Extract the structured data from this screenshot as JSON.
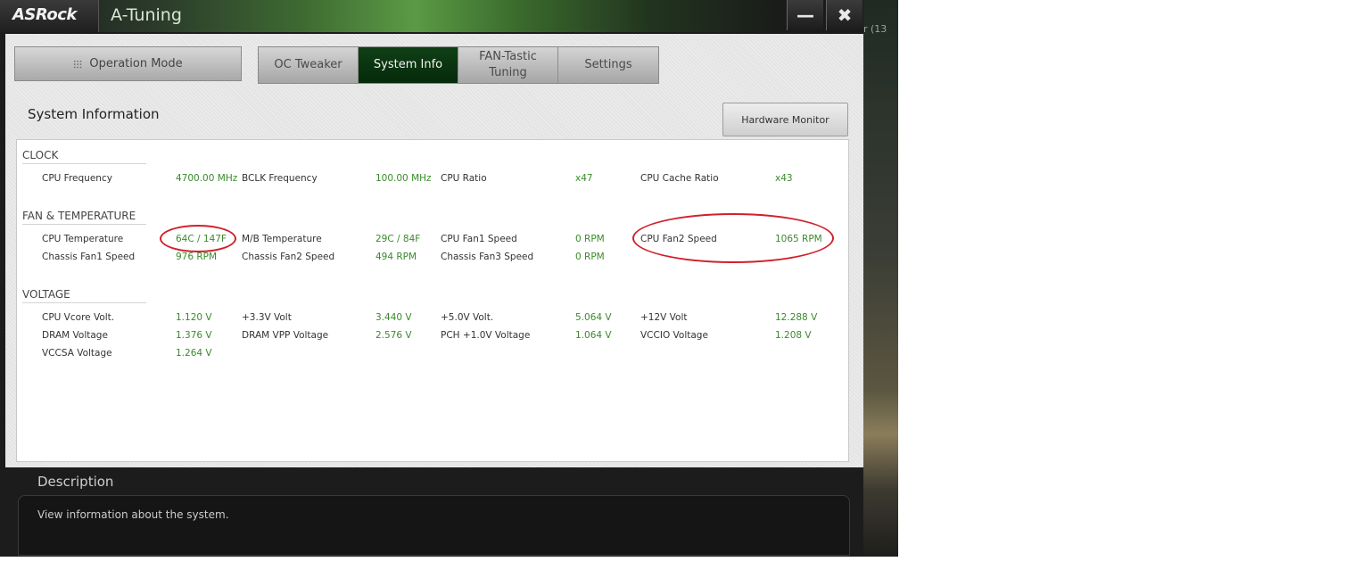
{
  "window": {
    "brand": "ASRock",
    "title": "A-Tuning",
    "minimize_glyph": "—",
    "close_glyph": "✖"
  },
  "background": {
    "snippet": "r (13"
  },
  "nav": {
    "operation_mode": "Operation Mode",
    "tabs": [
      {
        "label": "OC Tweaker",
        "active": false
      },
      {
        "label": "System Info",
        "active": true
      },
      {
        "label": "FAN-Tastic Tuning",
        "active": false
      },
      {
        "label": "Settings",
        "active": false
      }
    ]
  },
  "page": {
    "title": "System Information",
    "hardware_monitor_button": "Hardware Monitor"
  },
  "sections": {
    "clock": {
      "title": "CLOCK",
      "items": [
        {
          "label": "CPU Frequency",
          "value": "4700.00 MHz"
        },
        {
          "label": "BCLK Frequency",
          "value": "100.00 MHz"
        },
        {
          "label": "CPU Ratio",
          "value": "x47"
        },
        {
          "label": "CPU Cache Ratio",
          "value": "x43"
        }
      ]
    },
    "fan_temp": {
      "title": "FAN & TEMPERATURE",
      "items": [
        {
          "label": "CPU Temperature",
          "value": "64C / 147F"
        },
        {
          "label": "M/B Temperature",
          "value": "29C / 84F"
        },
        {
          "label": "CPU Fan1 Speed",
          "value": "0 RPM"
        },
        {
          "label": "CPU Fan2 Speed",
          "value": "1065 RPM"
        },
        {
          "label": "Chassis Fan1 Speed",
          "value": "976 RPM"
        },
        {
          "label": "Chassis Fan2 Speed",
          "value": "494 RPM"
        },
        {
          "label": "Chassis Fan3 Speed",
          "value": "0 RPM"
        }
      ]
    },
    "voltage": {
      "title": "VOLTAGE",
      "items": [
        {
          "label": "CPU Vcore Volt.",
          "value": "1.120 V"
        },
        {
          "label": "+3.3V Volt",
          "value": "3.440 V"
        },
        {
          "label": "+5.0V Volt.",
          "value": "5.064 V"
        },
        {
          "label": "+12V Volt",
          "value": "12.288 V"
        },
        {
          "label": "DRAM Voltage",
          "value": "1.376 V"
        },
        {
          "label": "DRAM VPP Voltage",
          "value": "2.576 V"
        },
        {
          "label": "PCH +1.0V Voltage",
          "value": "1.064 V"
        },
        {
          "label": "VCCIO Voltage",
          "value": "1.208 V"
        },
        {
          "label": "VCCSA Voltage",
          "value": "1.264 V"
        }
      ]
    }
  },
  "description": {
    "title": "Description",
    "text": "View information about the system."
  },
  "colors": {
    "value_green": "#3a8a2c",
    "active_tab": "#0a3410",
    "annotation_red": "#d0202c"
  }
}
